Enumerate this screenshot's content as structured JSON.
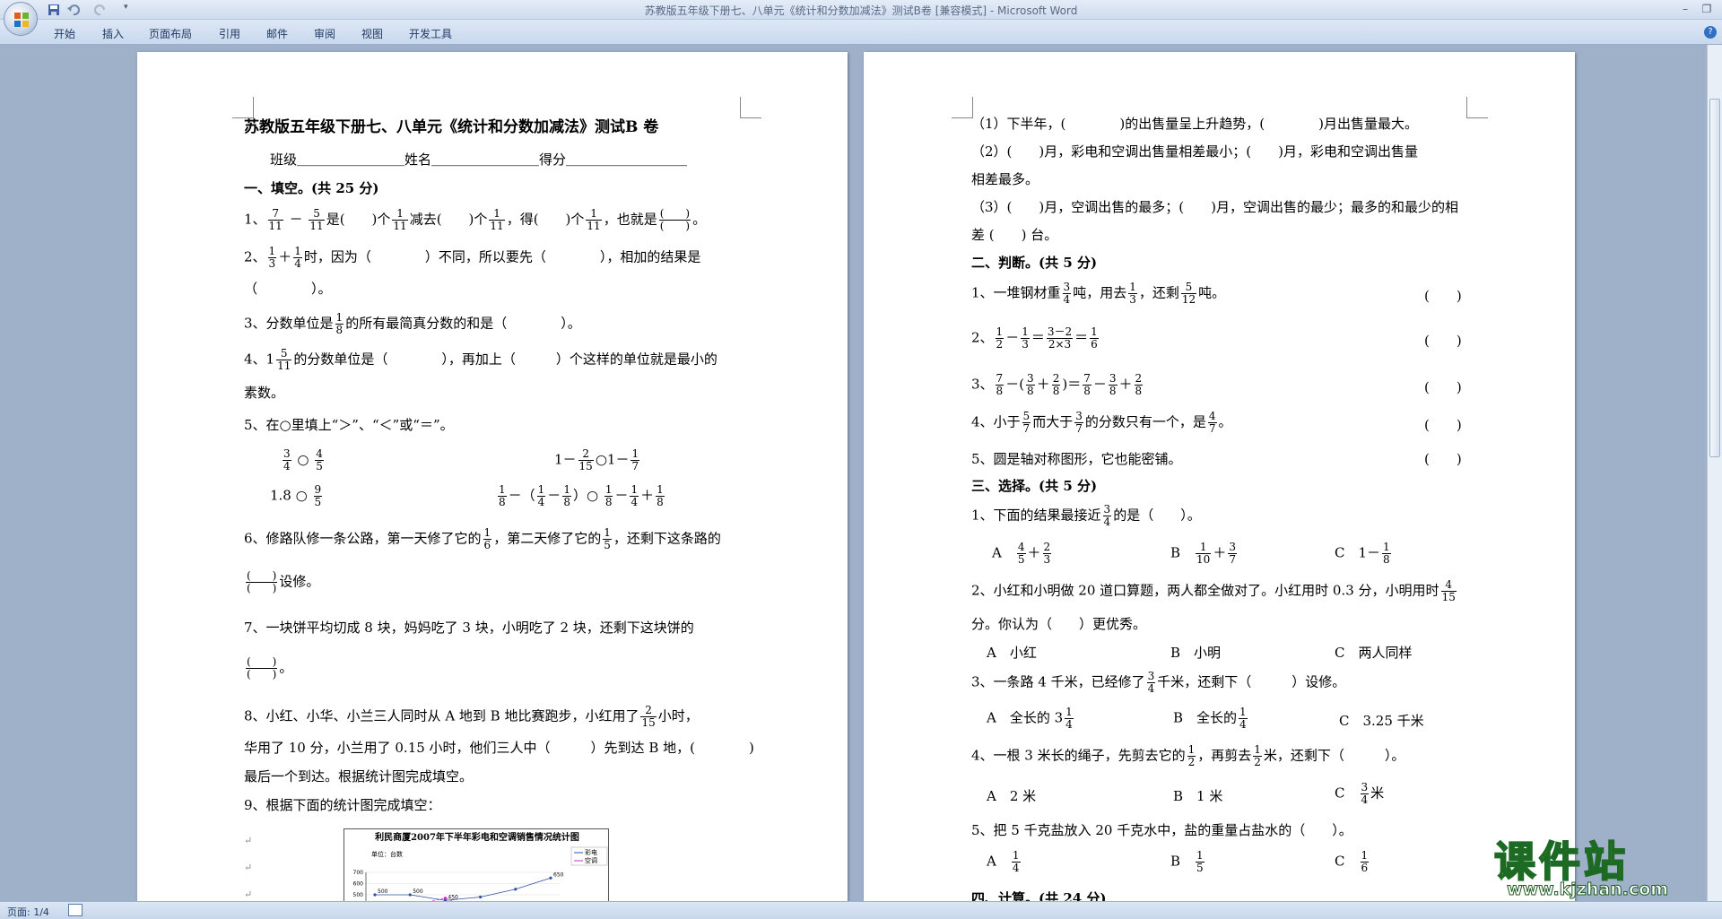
{
  "window": {
    "title": "苏教版五年级下册七、八单元《统计和分数加减法》测试B卷 [兼容模式] - Microsoft Word"
  },
  "ribbon": {
    "tabs": [
      "开始",
      "插入",
      "页面布局",
      "引用",
      "邮件",
      "审阅",
      "视图",
      "开发工具"
    ]
  },
  "status": {
    "page": "页面: 1/4"
  },
  "colors": {
    "ribbon": "#c8d8ee",
    "workspace": "#9fb1c9",
    "accent": "#2f6fc4"
  },
  "doc": {
    "title": "苏教版五年级下册七、八单元《统计和分数加减法》测试B 卷",
    "info": "班级＿＿＿＿＿＿＿＿姓名＿＿＿＿＿＿＿＿得分＿＿＿＿＿＿＿＿＿",
    "s1": "一、填空。(共 25 分)",
    "q1": {
      "a": "1、",
      "f1": [
        "7",
        "11"
      ],
      "op": "－",
      "f2": [
        "5",
        "11"
      ],
      "t1": "是(　　)个",
      "f3": [
        "1",
        "11"
      ],
      "t2": "减去(　　)个",
      "f4": [
        "1",
        "11"
      ],
      "t3": "，得(　　)个",
      "f5": [
        "1",
        "11"
      ],
      "t4": "，也就是",
      "t5": "。"
    },
    "q2": {
      "a": "2、",
      "f1": [
        "1",
        "3"
      ],
      "op": "＋",
      "f2": [
        "1",
        "4"
      ],
      "t1": "时，因为（　　　　）不同，所以要先（　　　　），相加的结果是",
      "l2": "（　　　　）。"
    },
    "q3": {
      "a": "3、分数单位是",
      "f": [
        "1",
        "8"
      ],
      "t": "的所有最简真分数的和是（　　　　）。"
    },
    "q4": {
      "a": "4、1",
      "f": [
        "5",
        "11"
      ],
      "t": "的分数单位是（　　　　），再加上（　　　）个这样的单位就是最小的",
      "l2": "素数。"
    },
    "q5": {
      "t": "5、在○里填上“＞”、“＜”或“＝”。",
      "r1a_f1": [
        "3",
        "4"
      ],
      "r1a_f2": [
        "4",
        "5"
      ],
      "r1b_pre": "1－",
      "r1b_f1": [
        "2",
        "15"
      ],
      "r1b_mid": "○1－",
      "r1b_f2": [
        "1",
        "7"
      ],
      "r2a": "1.8 ○",
      "r2a_f": [
        "9",
        "5"
      ],
      "r2b_f1": [
        "1",
        "8"
      ],
      "r2b_f2": [
        "1",
        "4"
      ],
      "r2b_f3": [
        "1",
        "8"
      ],
      "r2b_f4": [
        "1",
        "8"
      ],
      "r2b_f5": [
        "1",
        "4"
      ],
      "r2b_f6": [
        "1",
        "8"
      ]
    },
    "q6": {
      "t1": "6、修路队修一条公路，第一天修了它的",
      "f1": [
        "1",
        "6"
      ],
      "t2": "，第二天修了它的",
      "f2": [
        "1",
        "5"
      ],
      "t3": "，还剩下这条路的",
      "l2": "设修。"
    },
    "q7": {
      "t": "7、一块饼平均切成 8 块，妈妈吃了 3 块，小明吃了 2 块，还剩下这块饼的",
      "l2": "。"
    },
    "q8": {
      "t1": "8、小红、小华、小兰三人同时从 A 地到 B 地比赛跑步，小红用了",
      "f": [
        "2",
        "15"
      ],
      "t2": "小时，",
      "l2": "华用了 10 分，小兰用了 0.15 小时，他们三人中（　　　）先到达 B 地，(　　　　)",
      "l3": "最后一个到达。根据统计图完成填空。"
    },
    "q9": {
      "t": "9、根据下面的统计图完成填空："
    },
    "chart": {
      "title": "利民商厦2007年下半年彩电和空调销售情况统计图",
      "unit": "单位：台数",
      "legend": [
        "彩电",
        "空调"
      ]
    },
    "chart_data": {
      "type": "line",
      "title": "利民商厦2007年下半年彩电和空调销售情况统计图",
      "ylabel": "单位：台数",
      "yticks": [
        "700",
        "600",
        "500",
        "400",
        "300"
      ],
      "series": [
        {
          "name": "彩电",
          "values": [
            500,
            500,
            450,
            480,
            550,
            650
          ]
        },
        {
          "name": "空调",
          "values": [
            350,
            400,
            470,
            350,
            300,
            350
          ]
        }
      ],
      "labels": {
        "cd": [
          "500",
          "500",
          "450",
          "650"
        ],
        "kt": [
          "350",
          "350"
        ]
      }
    },
    "p2": {
      "l1": "（1）下半年，(　　　　)的出售量呈上升趋势，(　　　　)月出售量最大。",
      "l2": "（2）(　　)月，彩电和空调出售量相差最小；(　　)月，彩电和空调出售量",
      "l3": "相差最多。",
      "l4": "（3）(　　)月，空调出售的最多；(　　)月，空调出售的最少；最多的和最少的相",
      "l5": "差 (　　) 台。",
      "s2": "二、判断。(共 5 分)",
      "j1": {
        "a": "1、一堆钢材重",
        "f1": [
          "3",
          "4"
        ],
        "b": "吨，用去",
        "f2": [
          "1",
          "3"
        ],
        "c": "，还剩",
        "f3": [
          "5",
          "12"
        ],
        "d": "吨。"
      },
      "j2": {
        "a": "2、",
        "f1": [
          "1",
          "2"
        ],
        "op1": "－",
        "f2": [
          "1",
          "3"
        ],
        "eq": "＝",
        "f3": [
          "3－2",
          "2×3"
        ],
        "eq2": "＝",
        "f4": [
          "1",
          "6"
        ]
      },
      "j3": {
        "a": "3、",
        "f1": [
          "7",
          "8"
        ],
        "b": "－(",
        "f2": [
          "3",
          "8"
        ],
        "op": "＋",
        "f3": [
          "2",
          "8"
        ],
        "c": ")＝",
        "f4": [
          "7",
          "8"
        ],
        "d": "－",
        "f5": [
          "3",
          "8"
        ],
        "e": "＋",
        "f6": [
          "2",
          "8"
        ]
      },
      "j4": {
        "a": "4、小于",
        "f1": [
          "5",
          "7"
        ],
        "b": "而大于",
        "f2": [
          "3",
          "7"
        ],
        "c": "的分数只有一个，是",
        "f3": [
          "4",
          "7"
        ],
        "d": "。"
      },
      "j5": "5、圆是轴对称图形，它也能密铺。",
      "paren": "(　　)",
      "s3": "三、选择。(共 5 分)",
      "c1": {
        "t": "1、下面的结果最接近",
        "f": [
          "3",
          "4"
        ],
        "t2": "的是（　　）。",
        "A": "A",
        "Af1": [
          "4",
          "5"
        ],
        "Af2": [
          "2",
          "3"
        ],
        "B": "B",
        "Bf1": [
          "1",
          "10"
        ],
        "Bf2": [
          "3",
          "7"
        ],
        "C": "C",
        "Cpre": "1－",
        "Cf": [
          "1",
          "8"
        ]
      },
      "c2": {
        "t": "2、小红和小明做 20 道口算题，两人都全做对了。小红用时 0.3 分，小明用时",
        "f": [
          "4",
          "15"
        ],
        "l2": "分。你认为（　　）更优秀。",
        "A": "A　小红",
        "B": "B　小明",
        "C": "C　两人同样"
      },
      "c3": {
        "t": "3、一条路 4 千米，已经修了",
        "f": [
          "3",
          "4"
        ],
        "t2": "千米，还剩下（　　　）设修。",
        "A": "A　全长的 3",
        "Af": [
          "1",
          "4"
        ],
        "B": "B　全长的",
        "Bf": [
          "1",
          "4"
        ],
        "C": "C　3.25 千米"
      },
      "c4": {
        "t": "4、一根 3 米长的绳子，先剪去它的",
        "f1": [
          "1",
          "2"
        ],
        "t2": "，再剪去",
        "f2": [
          "1",
          "2"
        ],
        "t3": "米，还剩下（　　　）。",
        "A": "A　2 米",
        "B": "B　1 米",
        "C": "C",
        "Cf": [
          "3",
          "4"
        ],
        "Cu": "米"
      },
      "c5": {
        "t": "5、把 5 千克盐放入 20 千克水中，盐的重量占盐水的（　　）。",
        "A": "A",
        "Af": [
          "1",
          "4"
        ],
        "B": "B",
        "Bf": [
          "1",
          "5"
        ],
        "C": "C",
        "Cf": [
          "1",
          "6"
        ]
      },
      "s4": "四、计算。(共 24 分)"
    }
  },
  "watermark": {
    "big": "课件站",
    "url": "www.kjzhan.com"
  }
}
